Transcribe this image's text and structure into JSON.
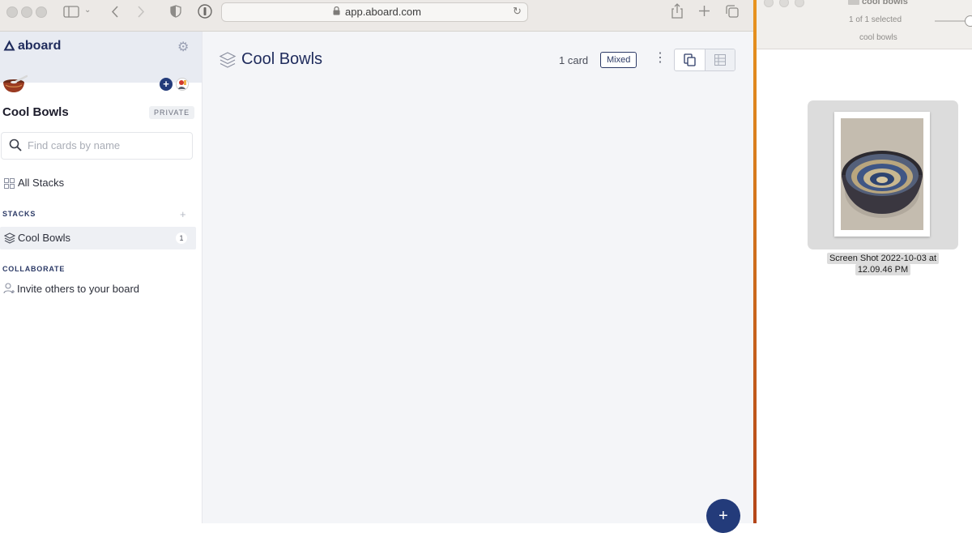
{
  "browser": {
    "url": "app.aboard.com"
  },
  "app": {
    "logo_text": "aboard",
    "board_title": "Cool Bowls",
    "privacy_badge": "PRIVATE",
    "search": {
      "placeholder": "Find cards by name",
      "value": ""
    },
    "nav_all_stacks": "All Stacks",
    "stacks_section_label": "STACKS",
    "stacks": [
      {
        "label": "Cool Bowls",
        "count": "1"
      }
    ],
    "collaborate_section_label": "COLLABORATE",
    "invite_label": "Invite others to your board",
    "accent_color": "#233b7a"
  },
  "main": {
    "title": "Cool Bowls",
    "card_count": "1 card",
    "filter_badge": "Mixed",
    "fab_label": "+"
  },
  "finder": {
    "window_title": "cool bowls",
    "status": "1 of 1 selected",
    "folder_name": "cool bowls",
    "file_name_line1": "Screen Shot 2022-10-03 at",
    "file_name_line2": "12.09.46 PM"
  }
}
